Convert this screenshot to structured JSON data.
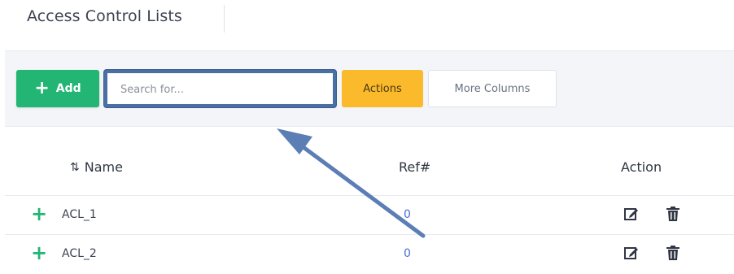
{
  "header": {
    "title": "Access Control Lists"
  },
  "toolbar": {
    "add_label": "Add",
    "search_placeholder": "Search for...",
    "actions_label": "Actions",
    "more_columns_label": "More Columns"
  },
  "table": {
    "columns": {
      "name": "Name",
      "ref": "Ref#",
      "action": "Action"
    },
    "rows": [
      {
        "name": "ACL_1",
        "ref": "0"
      },
      {
        "name": "ACL_2",
        "ref": "0"
      }
    ]
  },
  "colors": {
    "add_button": "#22b573",
    "actions_button": "#fbb92c",
    "highlight": "#4a6fa5",
    "ref_link": "#4a6cd4"
  },
  "icons": {
    "add": "plus-icon",
    "sort": "sort-icon",
    "expand": "plus-icon",
    "edit": "edit-icon",
    "delete": "trash-icon"
  }
}
